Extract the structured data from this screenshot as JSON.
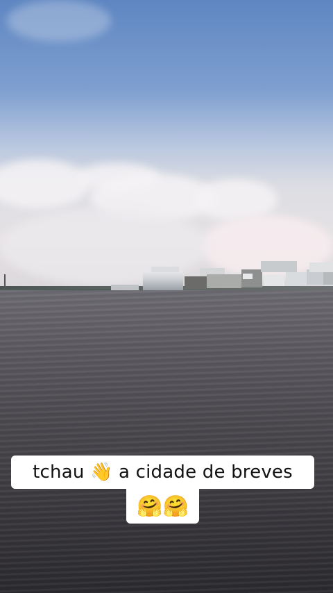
{
  "caption": {
    "line1": "tchau 👋  a cidade de breves",
    "line2": "🤗🤗"
  }
}
